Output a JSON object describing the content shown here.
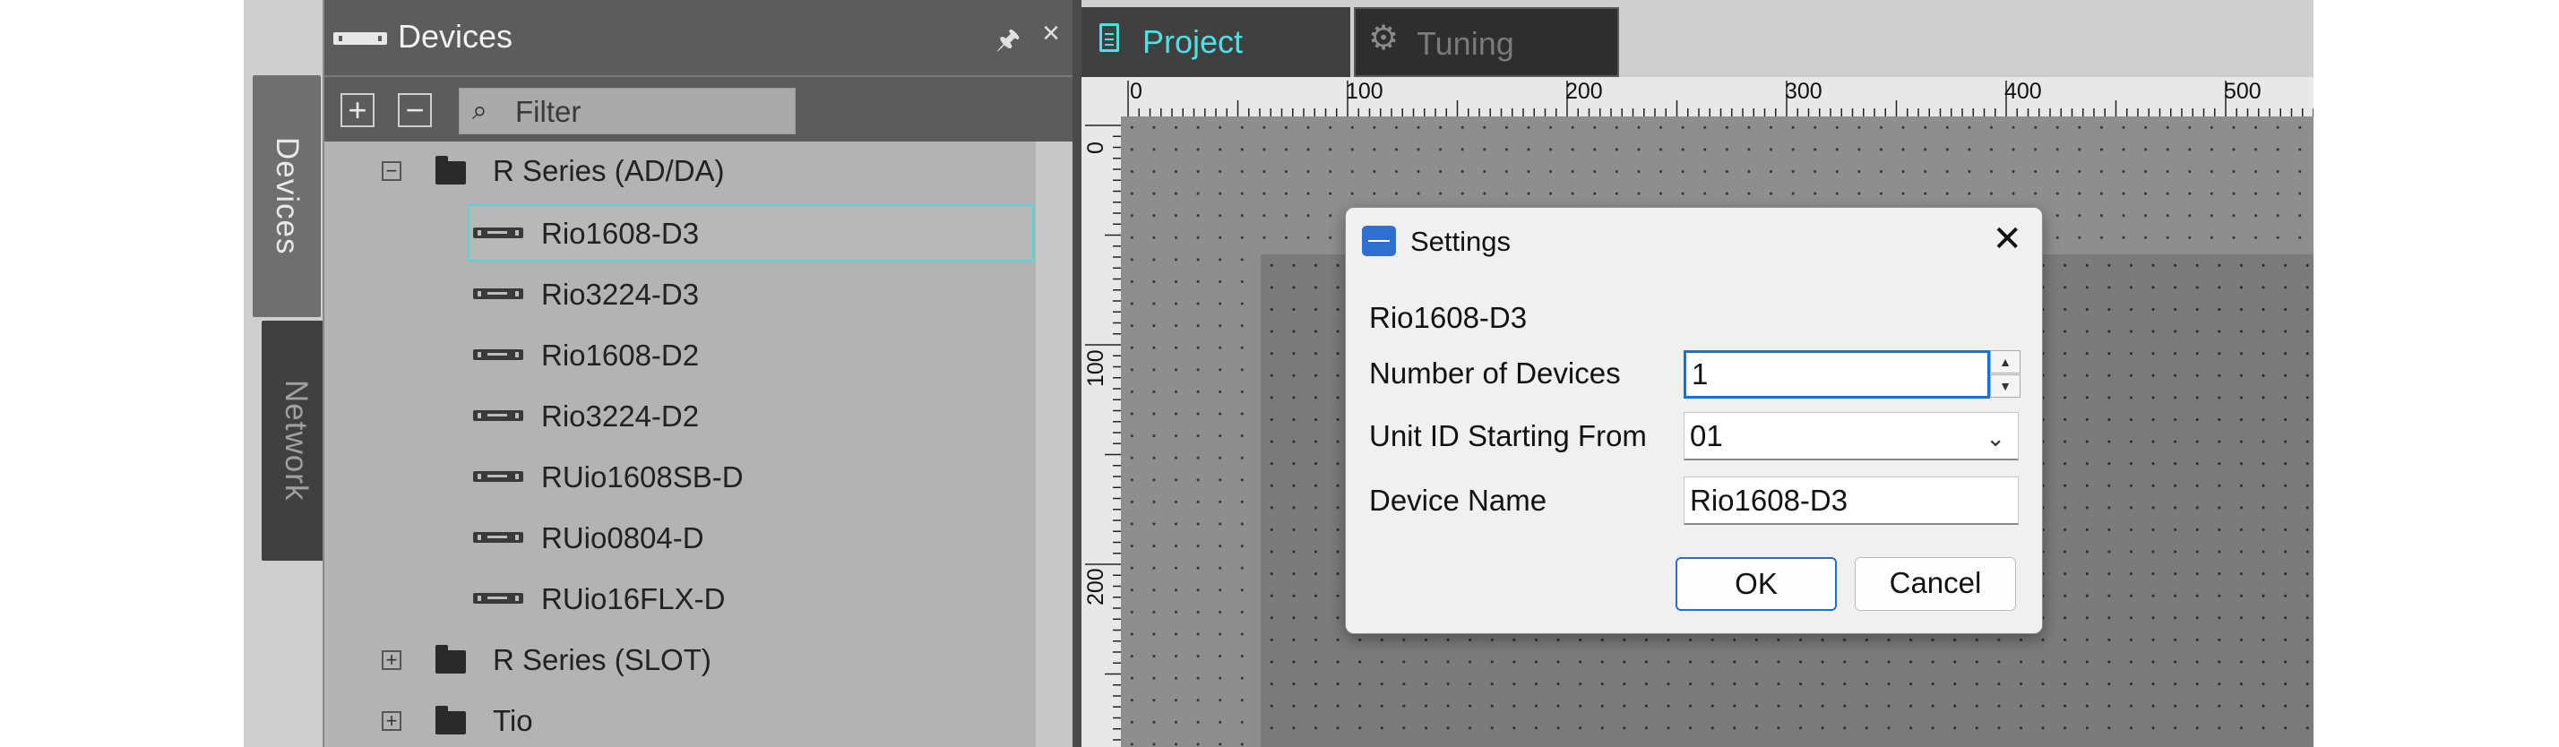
{
  "side_tabs": {
    "devices": "Devices",
    "network": "Network"
  },
  "devices_panel": {
    "title": "Devices",
    "filter_placeholder": "Filter",
    "tree": [
      {
        "label": "R Series (AD/DA)",
        "expanded": true
      },
      {
        "label": "Rio1608-D3",
        "selected": true
      },
      {
        "label": "Rio3224-D3"
      },
      {
        "label": "Rio1608-D2"
      },
      {
        "label": "Rio3224-D2"
      },
      {
        "label": "RUio1608SB-D"
      },
      {
        "label": "RUio0804-D"
      },
      {
        "label": "RUio16FLX-D"
      },
      {
        "label": "R Series (SLOT)",
        "expanded": false
      },
      {
        "label": "Tio",
        "expanded": false
      }
    ]
  },
  "editor_tabs": {
    "project": "Project",
    "tuning": "Tuning"
  },
  "ruler": {
    "top_marks": [
      "0",
      "100",
      "200",
      "300",
      "400",
      "500"
    ],
    "left_marks": [
      "0",
      "100",
      "200"
    ]
  },
  "dialog": {
    "title": "Settings",
    "device_model": "Rio1608-D3",
    "num_devices_label": "Number of Devices",
    "num_devices_value": "1",
    "unit_id_label": "Unit ID Starting From",
    "unit_id_value": "01",
    "device_name_label": "Device Name",
    "device_name_value": "Rio1608-D3",
    "ok_label": "OK",
    "cancel_label": "Cancel"
  },
  "colors": {
    "accent_cyan": "#4fe0e6",
    "selection_border": "#5ad4d9",
    "focus_blue": "#1f6fd0",
    "panel_dark": "#5c5c5c"
  }
}
